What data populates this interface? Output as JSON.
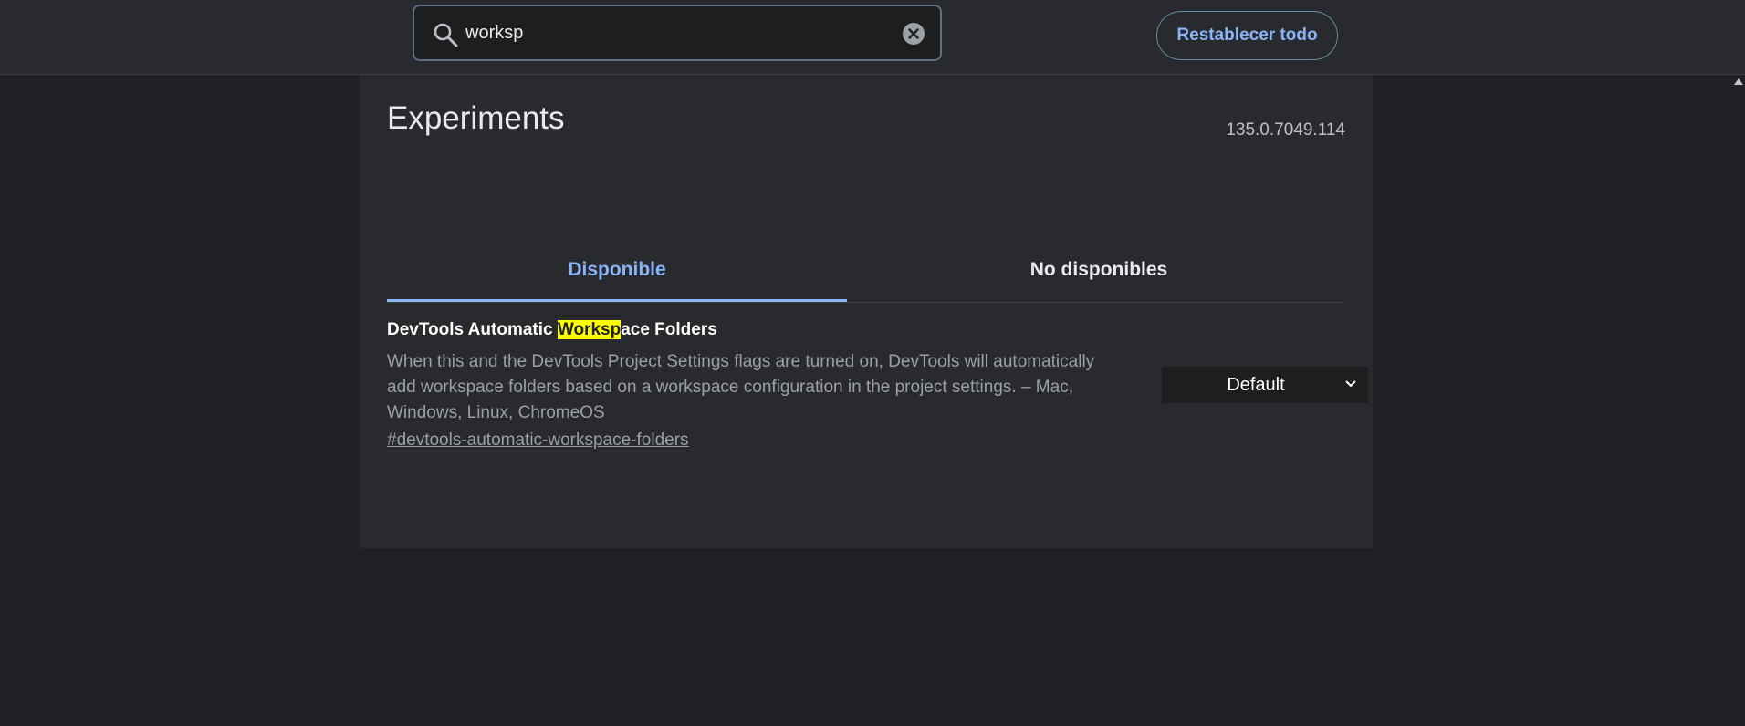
{
  "search": {
    "value": "worksp",
    "icon": "search-icon",
    "clear_icon": "clear-icon"
  },
  "header": {
    "reset_label": "Restablecer todo"
  },
  "page": {
    "title": "Experiments",
    "version": "135.0.7049.114"
  },
  "tabs": [
    {
      "label": "Disponible",
      "active": true
    },
    {
      "label": "No disponibles",
      "active": false
    }
  ],
  "experiment": {
    "title_before": "DevTools Automatic ",
    "title_match": "Worksp",
    "title_after": "ace Folders",
    "description": "When this and the DevTools Project Settings flags are turned on, DevTools will automatically add workspace folders based on a workspace configuration in the project settings. – Mac, Windows, Linux, ChromeOS",
    "link": "#devtools-automatic-workspace-folders",
    "select_value": "Default"
  },
  "colors": {
    "background": "#202124",
    "panel": "#292a2d",
    "accent": "#8ab4f8",
    "highlight": "#ffff00"
  }
}
